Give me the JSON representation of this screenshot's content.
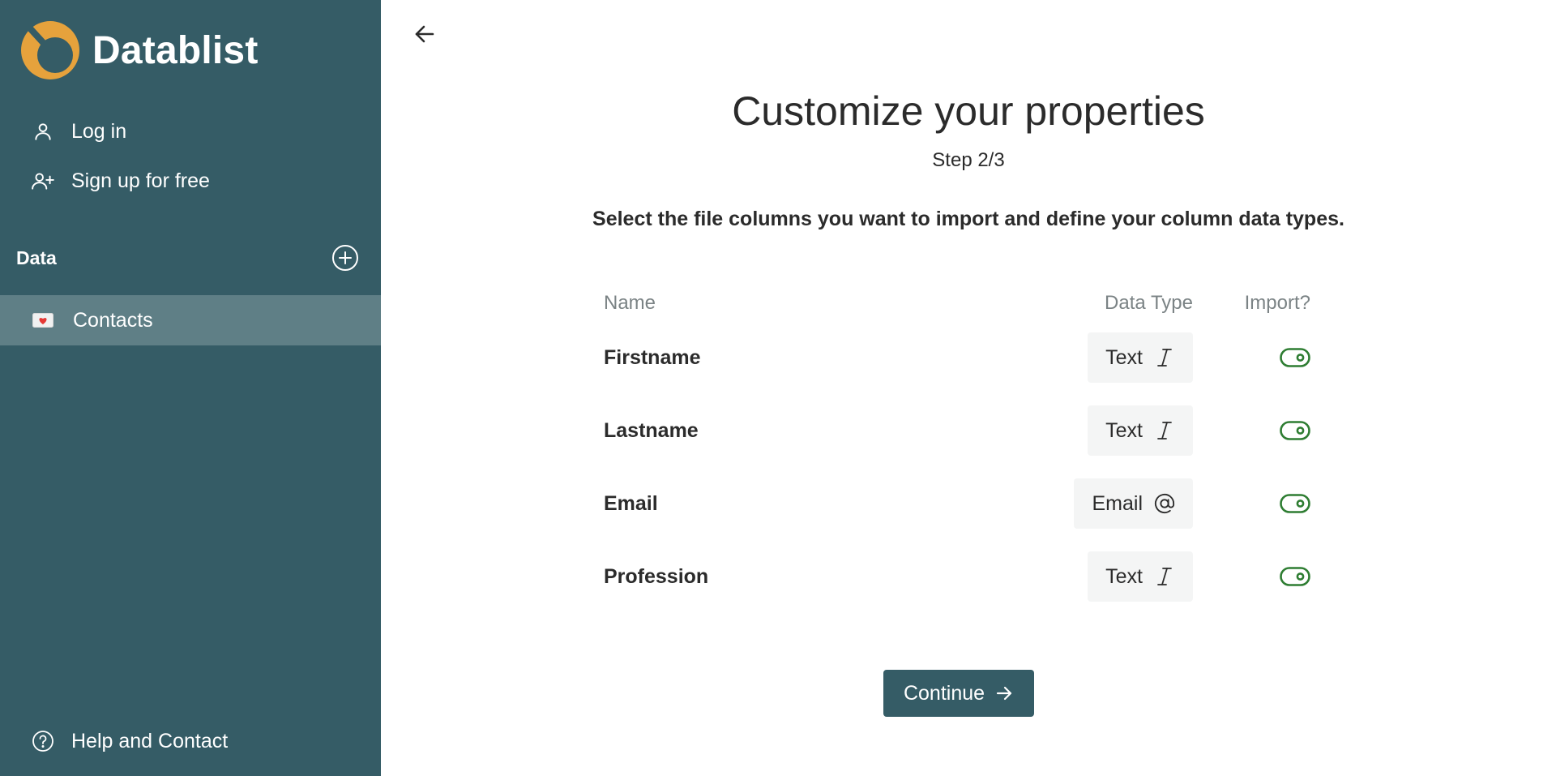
{
  "brand": {
    "name": "Datablist"
  },
  "nav": {
    "login_label": "Log in",
    "signup_label": "Sign up for free",
    "help_label": "Help and Contact"
  },
  "sidebar": {
    "section_title": "Data",
    "items": [
      {
        "label": "Contacts",
        "icon": "love-letter-emoji"
      }
    ]
  },
  "main": {
    "title": "Customize your properties",
    "step": "Step 2/3",
    "subtitle": "Select the file columns you want to import and define your column data types.",
    "columns": {
      "name": "Name",
      "type": "Data Type",
      "import": "Import?"
    },
    "rows": [
      {
        "name": "Firstname",
        "type": "Text",
        "type_icon": "text-cursor-icon",
        "import": true
      },
      {
        "name": "Lastname",
        "type": "Text",
        "type_icon": "text-cursor-icon",
        "import": true
      },
      {
        "name": "Email",
        "type": "Email",
        "type_icon": "at-icon",
        "import": true
      },
      {
        "name": "Profession",
        "type": "Text",
        "type_icon": "text-cursor-icon",
        "import": true
      }
    ],
    "continue_label": "Continue"
  },
  "colors": {
    "sidebar_bg": "#355c66",
    "sidebar_active": "#5f7f86",
    "logo_orange": "#e6a23c",
    "toggle_green": "#2e7d32",
    "chip_bg": "#f4f5f5"
  }
}
